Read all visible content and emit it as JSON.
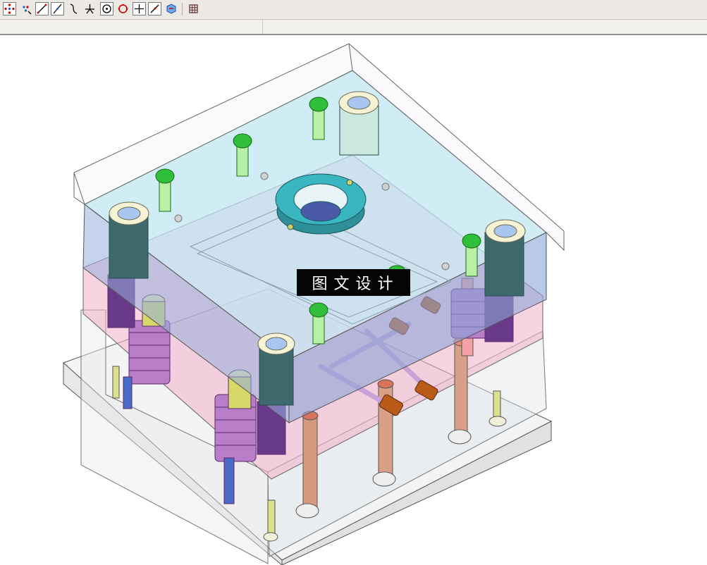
{
  "toolbar": {
    "tools": [
      {
        "icon": "select-all-icon"
      },
      {
        "icon": "move-points-icon"
      },
      {
        "icon": "line-icon"
      },
      {
        "icon": "line-angle-icon"
      },
      {
        "icon": "curve-icon"
      },
      {
        "icon": "branch-icon"
      },
      {
        "icon": "circle-center-icon"
      },
      {
        "icon": "circle-icon"
      },
      {
        "icon": "crosshair-icon"
      },
      {
        "icon": "pen-line-icon"
      },
      {
        "icon": "shaded-view-icon"
      },
      {
        "icon": "grid-icon"
      }
    ]
  },
  "statusbar": {
    "fields": [
      "",
      "",
      ""
    ]
  },
  "watermark": {
    "text": "图文设计"
  },
  "colors": {
    "toolbar_bg": "#ece9e4",
    "plate_top": "#bfe6f2",
    "plate_pink": "#f2c2d2",
    "bolt_green": "#2fbf3a",
    "ring_teal": "#3aa7b0",
    "spring_purple": "#b87fc8",
    "rod_orange": "#c87850"
  }
}
